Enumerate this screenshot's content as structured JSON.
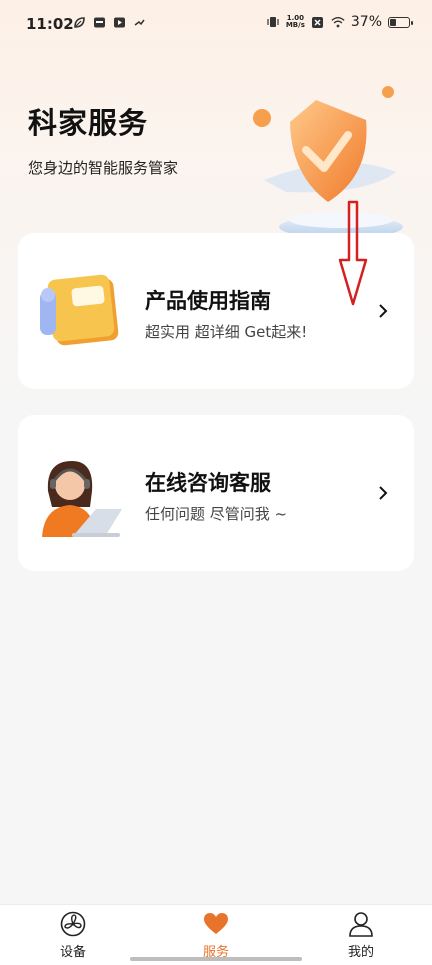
{
  "status_bar": {
    "time": "11:02",
    "left_icons": [
      "leaf-icon",
      "calendar-box-icon",
      "play-box-icon",
      "signal-arrow-icon"
    ],
    "right_icons": [
      "vibrate-icon",
      "close-box-icon",
      "wifi-icon"
    ],
    "net_speed_value": "1.00",
    "net_speed_unit": "MB/s",
    "battery_percent": "37%",
    "battery_level": 0.37
  },
  "header": {
    "title": "科家服务",
    "subtitle": "您身边的智能服务管家"
  },
  "cards": [
    {
      "title": "产品使用指南",
      "description": "超实用 超详细 Get起来!",
      "icon": "guide-book-illustration"
    },
    {
      "title": "在线咨询客服",
      "description": "任何问题 尽管问我 ~",
      "icon": "support-agent-illustration"
    }
  ],
  "tabbar": {
    "tabs": [
      {
        "label": "设备",
        "icon": "fan-icon",
        "active": false
      },
      {
        "label": "服务",
        "icon": "heart-icon",
        "active": true
      },
      {
        "label": "我的",
        "icon": "user-icon",
        "active": false
      }
    ],
    "active_color": "#e8742c"
  },
  "colors": {
    "accent": "#e8742c",
    "annotation_arrow": "#d42020"
  }
}
